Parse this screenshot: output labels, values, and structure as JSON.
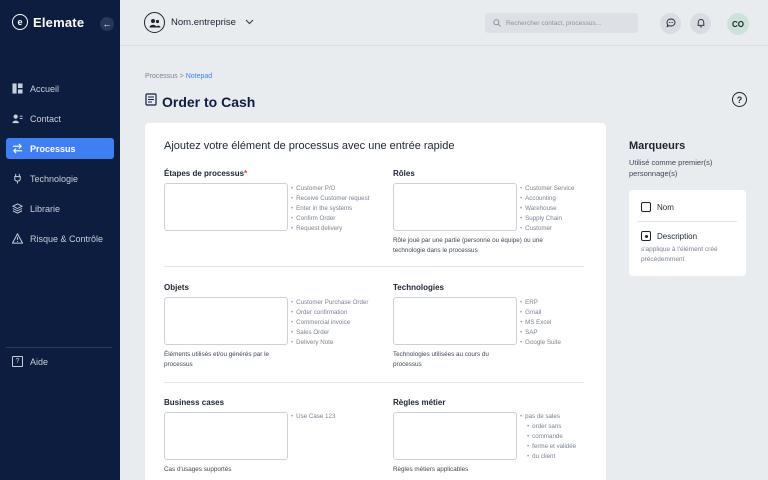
{
  "app": {
    "logo_mark": "e",
    "name": "Elemate",
    "collapse_glyph": "←"
  },
  "sidebar": {
    "items": [
      {
        "label": "Accueil"
      },
      {
        "label": "Contact"
      },
      {
        "label": "Processus",
        "active": true
      },
      {
        "label": "Technologie"
      },
      {
        "label": "Librarie"
      },
      {
        "label": "Risque & Contrôle"
      }
    ],
    "help": {
      "label": "Aide",
      "glyph": "?"
    }
  },
  "topbar": {
    "company": "Nom.entreprise",
    "search_placeholder": "Rechercher contact, processus...",
    "avatar_initials": "CO"
  },
  "breadcrumb": {
    "root": "Processus",
    "separator": ">",
    "current": "Notepad"
  },
  "page": {
    "title": "Order to Cash",
    "help_glyph": "?"
  },
  "form": {
    "title": "Ajoutez votre élément de processus avec une entrée rapide",
    "sections": {
      "etapes": {
        "label": "Étapes de processus",
        "required_mark": "*",
        "hints": [
          "Customer P/O",
          "Receive Customer request",
          "Enter in the systems",
          "Confirm Order",
          "Request delivery"
        ]
      },
      "roles": {
        "label": "Rôles",
        "hints": [
          "Customer Service",
          "Accounting",
          "Warehouse",
          "Supply Chain",
          "Customer"
        ],
        "help": "Rôle joué par une partie (personne ou équipe) ou une technologie dans le processus"
      },
      "objets": {
        "label": "Objets",
        "hints": [
          "Customer Purchase Order",
          "Order confirmation",
          "Commercial invoice",
          "Sales Order",
          "Delivery Note"
        ],
        "help": "Éléments utilisés et/ou générés par le processus"
      },
      "technologies": {
        "label": "Technologies",
        "hints": [
          "ERP",
          "Gmail",
          "MS Excel",
          "SAP",
          "Google Suite"
        ],
        "help": "Technologies utilisées au cours du processus"
      },
      "business": {
        "label": "Business cases",
        "hints": [
          "Use Case 123"
        ],
        "help": "Cas d'usages supportés"
      },
      "regles": {
        "label": "Règles métier",
        "hints": [
          "pas de sales",
          "order sans",
          "commande",
          "ferme et validée",
          "du client"
        ],
        "help": "Règles métiers applicables"
      }
    }
  },
  "markers": {
    "title": "Marqueurs",
    "subtitle": "Utilisé comme premier(s) personnage(s)",
    "items": [
      {
        "label": "Nom",
        "checked": false
      },
      {
        "label": "Description",
        "checked": true,
        "desc": "s'applique à l'élément créé précédemment"
      }
    ]
  }
}
